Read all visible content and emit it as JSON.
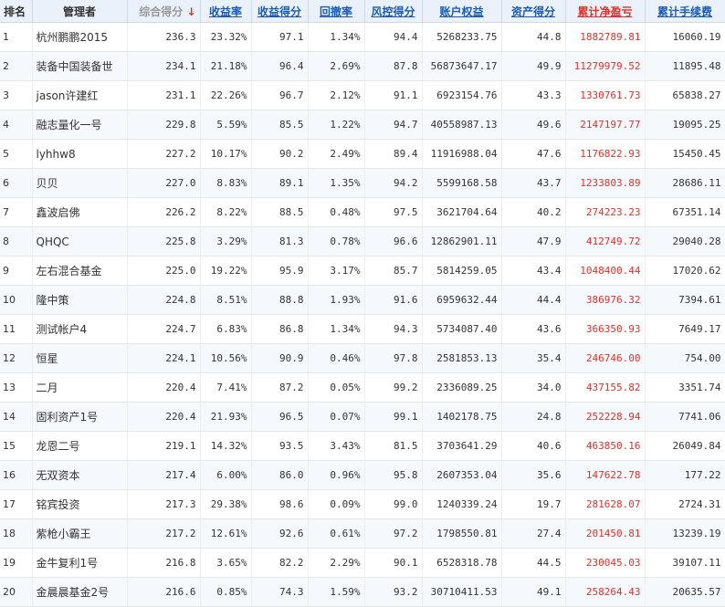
{
  "headers": {
    "rank": "排名",
    "manager": "管理者",
    "composite": "综合得分",
    "return_rate": "收益率",
    "return_score": "收益得分",
    "drawdown": "回撤率",
    "risk_score": "风控得分",
    "equity": "账户权益",
    "asset_score": "资产得分",
    "cum_profit": "累计净盈亏",
    "cum_fee": "累计手续费"
  },
  "sort_arrow": "↓",
  "colors": {
    "header_bg": "#eaf1fa",
    "link": "#1c5bb5",
    "profit": "#e0302a",
    "row_alt": "#f5f9fd"
  },
  "rows": [
    {
      "rank": "1",
      "name": "杭州鹏鹏2015",
      "composite": "236.3",
      "ret": "23.32%",
      "ret_score": "97.1",
      "dd": "1.34%",
      "risk": "94.4",
      "equity": "5268233.75",
      "asset": "44.8",
      "profit": "1882789.81",
      "fee": "16060.19"
    },
    {
      "rank": "2",
      "name": "装备中国装备世",
      "composite": "234.1",
      "ret": "21.18%",
      "ret_score": "96.4",
      "dd": "2.69%",
      "risk": "87.8",
      "equity": "56873647.17",
      "asset": "49.9",
      "profit": "11279979.52",
      "fee": "11895.48"
    },
    {
      "rank": "3",
      "name": "jason许建红",
      "composite": "231.1",
      "ret": "22.26%",
      "ret_score": "96.7",
      "dd": "2.12%",
      "risk": "91.1",
      "equity": "6923154.76",
      "asset": "43.3",
      "profit": "1330761.73",
      "fee": "65838.27"
    },
    {
      "rank": "4",
      "name": "融志量化一号",
      "composite": "229.8",
      "ret": "5.59%",
      "ret_score": "85.5",
      "dd": "1.22%",
      "risk": "94.7",
      "equity": "40558987.13",
      "asset": "49.6",
      "profit": "2147197.77",
      "fee": "19095.25"
    },
    {
      "rank": "5",
      "name": "lyhhw8",
      "composite": "227.2",
      "ret": "10.17%",
      "ret_score": "90.2",
      "dd": "2.49%",
      "risk": "89.4",
      "equity": "11916988.04",
      "asset": "47.6",
      "profit": "1176822.93",
      "fee": "15450.45"
    },
    {
      "rank": "6",
      "name": "贝贝",
      "composite": "227.0",
      "ret": "8.83%",
      "ret_score": "89.1",
      "dd": "1.35%",
      "risk": "94.2",
      "equity": "5599168.58",
      "asset": "43.7",
      "profit": "1233803.89",
      "fee": "28686.11"
    },
    {
      "rank": "7",
      "name": "鑫波启佛",
      "composite": "226.2",
      "ret": "8.22%",
      "ret_score": "88.5",
      "dd": "0.48%",
      "risk": "97.5",
      "equity": "3621704.64",
      "asset": "40.2",
      "profit": "274223.23",
      "fee": "67351.14"
    },
    {
      "rank": "8",
      "name": "QHQC",
      "composite": "225.8",
      "ret": "3.29%",
      "ret_score": "81.3",
      "dd": "0.78%",
      "risk": "96.6",
      "equity": "12862901.11",
      "asset": "47.9",
      "profit": "412749.72",
      "fee": "29040.28"
    },
    {
      "rank": "9",
      "name": "左右混合基金",
      "composite": "225.0",
      "ret": "19.22%",
      "ret_score": "95.9",
      "dd": "3.17%",
      "risk": "85.7",
      "equity": "5814259.05",
      "asset": "43.4",
      "profit": "1048400.44",
      "fee": "17020.62"
    },
    {
      "rank": "10",
      "name": "隆中策",
      "composite": "224.8",
      "ret": "8.51%",
      "ret_score": "88.8",
      "dd": "1.93%",
      "risk": "91.6",
      "equity": "6959632.44",
      "asset": "44.4",
      "profit": "386976.32",
      "fee": "7394.61"
    },
    {
      "rank": "11",
      "name": "测试帐户4",
      "composite": "224.7",
      "ret": "6.83%",
      "ret_score": "86.8",
      "dd": "1.34%",
      "risk": "94.3",
      "equity": "5734087.40",
      "asset": "43.6",
      "profit": "366350.93",
      "fee": "7649.17"
    },
    {
      "rank": "12",
      "name": "恒星",
      "composite": "224.1",
      "ret": "10.56%",
      "ret_score": "90.9",
      "dd": "0.46%",
      "risk": "97.8",
      "equity": "2581853.13",
      "asset": "35.4",
      "profit": "246746.00",
      "fee": "754.00"
    },
    {
      "rank": "13",
      "name": "二月",
      "composite": "220.4",
      "ret": "7.41%",
      "ret_score": "87.2",
      "dd": "0.05%",
      "risk": "99.2",
      "equity": "2336089.25",
      "asset": "34.0",
      "profit": "437155.82",
      "fee": "3351.74"
    },
    {
      "rank": "14",
      "name": "固利资产1号",
      "composite": "220.4",
      "ret": "21.93%",
      "ret_score": "96.5",
      "dd": "0.07%",
      "risk": "99.1",
      "equity": "1402178.75",
      "asset": "24.8",
      "profit": "252228.94",
      "fee": "7741.06"
    },
    {
      "rank": "15",
      "name": "龙恩二号",
      "composite": "219.1",
      "ret": "14.32%",
      "ret_score": "93.5",
      "dd": "3.43%",
      "risk": "81.5",
      "equity": "3703641.29",
      "asset": "40.6",
      "profit": "463850.16",
      "fee": "26049.84"
    },
    {
      "rank": "16",
      "name": "无双资本",
      "composite": "217.4",
      "ret": "6.00%",
      "ret_score": "86.0",
      "dd": "0.96%",
      "risk": "95.8",
      "equity": "2607353.04",
      "asset": "35.6",
      "profit": "147622.78",
      "fee": "177.22"
    },
    {
      "rank": "17",
      "name": "铭宾投资",
      "composite": "217.3",
      "ret": "29.38%",
      "ret_score": "98.6",
      "dd": "0.09%",
      "risk": "99.0",
      "equity": "1240339.24",
      "asset": "19.7",
      "profit": "281628.07",
      "fee": "2724.31"
    },
    {
      "rank": "18",
      "name": "紫枪小霸王",
      "composite": "217.2",
      "ret": "12.61%",
      "ret_score": "92.6",
      "dd": "0.61%",
      "risk": "97.2",
      "equity": "1798550.81",
      "asset": "27.4",
      "profit": "201450.81",
      "fee": "13239.19"
    },
    {
      "rank": "19",
      "name": "金牛复利1号",
      "composite": "216.8",
      "ret": "3.65%",
      "ret_score": "82.2",
      "dd": "2.29%",
      "risk": "90.1",
      "equity": "6528318.78",
      "asset": "44.5",
      "profit": "230045.03",
      "fee": "39107.11"
    },
    {
      "rank": "20",
      "name": "金晨晨基金2号",
      "composite": "216.6",
      "ret": "0.85%",
      "ret_score": "74.3",
      "dd": "1.59%",
      "risk": "93.2",
      "equity": "30710411.53",
      "asset": "49.1",
      "profit": "258264.43",
      "fee": "20635.57"
    }
  ]
}
